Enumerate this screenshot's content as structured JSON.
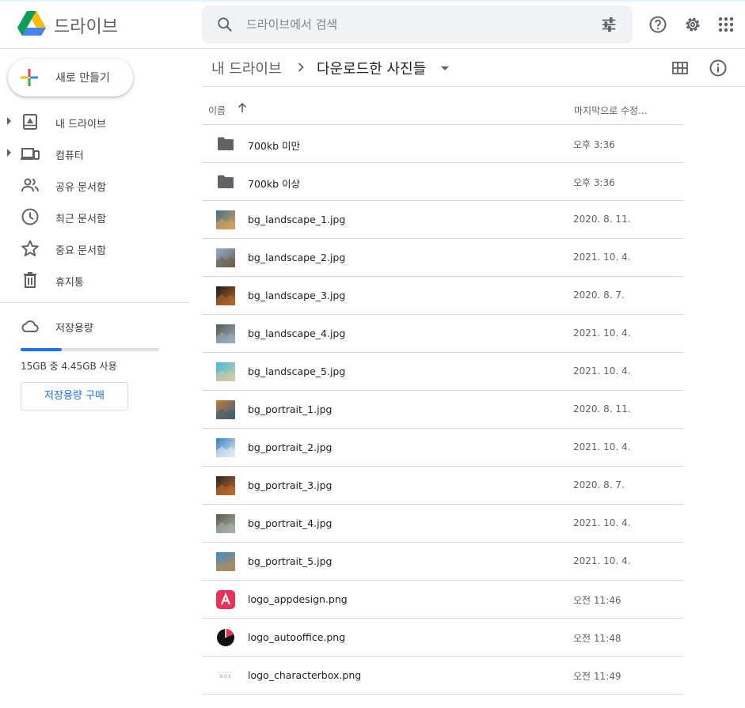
{
  "app": {
    "title": "드라이브"
  },
  "search": {
    "placeholder": "드라이브에서 검색"
  },
  "sidebar": {
    "new_label": "새로 만들기",
    "items": [
      {
        "label": "내 드라이브",
        "icon": "my-drive-icon",
        "expandable": true
      },
      {
        "label": "컴퓨터",
        "icon": "computers-icon",
        "expandable": true
      },
      {
        "label": "공유 문서함",
        "icon": "shared-icon",
        "expandable": false
      },
      {
        "label": "최근 문서함",
        "icon": "clock-icon",
        "expandable": false
      },
      {
        "label": "중요 문서함",
        "icon": "star-icon",
        "expandable": false
      },
      {
        "label": "휴지통",
        "icon": "trash-icon",
        "expandable": false
      }
    ],
    "storage": {
      "label": "저장용량",
      "usage_text": "15GB 중 4.45GB 사용",
      "used_fraction": 0.297,
      "buy_label": "저장용량 구매"
    }
  },
  "breadcrumb": {
    "root": "내 드라이브",
    "current": "다운로드한 사진들"
  },
  "list": {
    "col_name": "이름",
    "col_modified": "마지막으로 수정...",
    "rows": [
      {
        "name": "700kb 미만",
        "date": "오후 3:36",
        "type": "folder"
      },
      {
        "name": "700kb 이상",
        "date": "오후 3:36",
        "type": "folder"
      },
      {
        "name": "bg_landscape_1.jpg",
        "date": "2020. 8. 11.",
        "type": "image"
      },
      {
        "name": "bg_landscape_2.jpg",
        "date": "2021. 10. 4.",
        "type": "image"
      },
      {
        "name": "bg_landscape_3.jpg",
        "date": "2020. 8. 7.",
        "type": "image"
      },
      {
        "name": "bg_landscape_4.jpg",
        "date": "2021. 10. 4.",
        "type": "image"
      },
      {
        "name": "bg_landscape_5.jpg",
        "date": "2021. 10. 4.",
        "type": "image"
      },
      {
        "name": "bg_portrait_1.jpg",
        "date": "2020. 8. 11.",
        "type": "image"
      },
      {
        "name": "bg_portrait_2.jpg",
        "date": "2021. 10. 4.",
        "type": "image"
      },
      {
        "name": "bg_portrait_3.jpg",
        "date": "2020. 8. 7.",
        "type": "image"
      },
      {
        "name": "bg_portrait_4.jpg",
        "date": "2021. 10. 4.",
        "type": "image"
      },
      {
        "name": "bg_portrait_5.jpg",
        "date": "2021. 10. 4.",
        "type": "image"
      },
      {
        "name": "logo_appdesign.png",
        "date": "오전 11:46",
        "type": "logo-appdesign"
      },
      {
        "name": "logo_autooffice.png",
        "date": "오전 11:48",
        "type": "logo-autooffice"
      },
      {
        "name": "logo_characterbox.png",
        "date": "오전 11:49",
        "type": "logo-characterbox"
      }
    ]
  },
  "colors": {
    "accent": "#1a73e8",
    "folder": "#5f6368",
    "divider": "#dadce0"
  }
}
